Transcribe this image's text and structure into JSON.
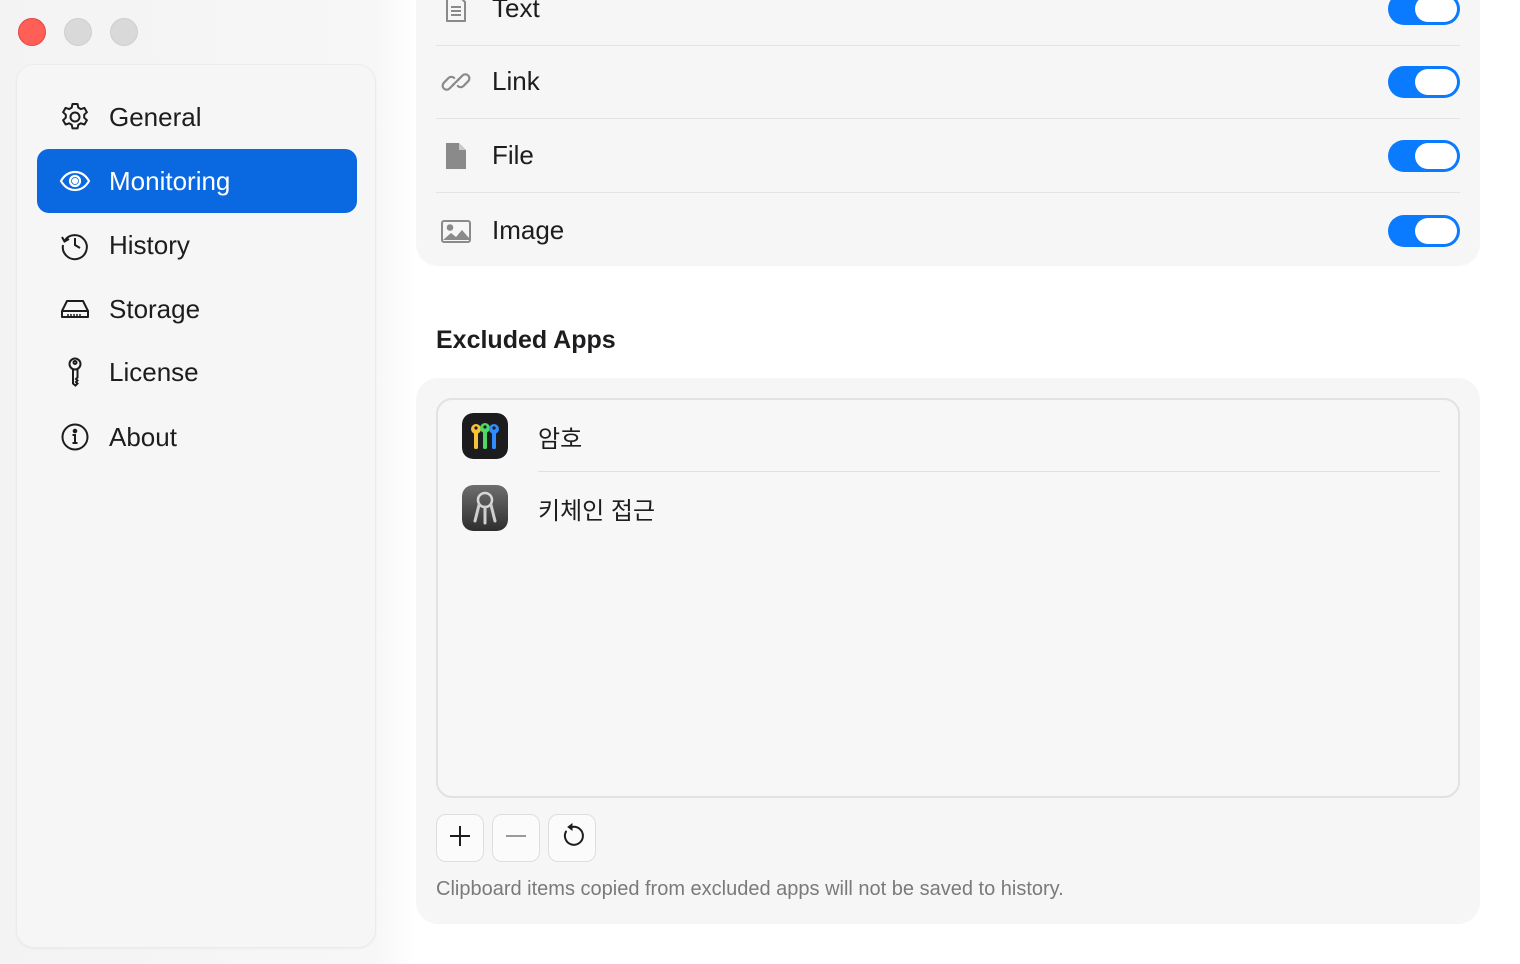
{
  "window": {
    "controls": [
      "close",
      "minimize",
      "maximize"
    ]
  },
  "sidebar": {
    "items": [
      {
        "label": "General",
        "icon": "gear-icon"
      },
      {
        "label": "Monitoring",
        "icon": "eye-icon",
        "active": true
      },
      {
        "label": "History",
        "icon": "history-icon"
      },
      {
        "label": "Storage",
        "icon": "drive-icon"
      },
      {
        "label": "License",
        "icon": "key-icon"
      },
      {
        "label": "About",
        "icon": "info-icon"
      }
    ]
  },
  "content_types": {
    "items": [
      {
        "label": "Text",
        "icon": "text-document-icon",
        "enabled": true
      },
      {
        "label": "Link",
        "icon": "link-icon",
        "enabled": true
      },
      {
        "label": "File",
        "icon": "file-icon",
        "enabled": true
      },
      {
        "label": "Image",
        "icon": "image-icon",
        "enabled": true
      }
    ]
  },
  "excluded_apps": {
    "title": "Excluded Apps",
    "apps": [
      {
        "name": "암호",
        "icon": "passwords-app-icon"
      },
      {
        "name": "키체인 접근",
        "icon": "keychain-access-app-icon"
      }
    ],
    "buttons": {
      "add": "plus-icon",
      "remove": "minus-icon",
      "reset": "reset-icon"
    },
    "footnote": "Clipboard items copied from excluded apps will not be saved to history."
  },
  "colors": {
    "accent": "#0a68e0",
    "toggle_on": "#0a7aff",
    "close_button": "#ff5f57"
  }
}
